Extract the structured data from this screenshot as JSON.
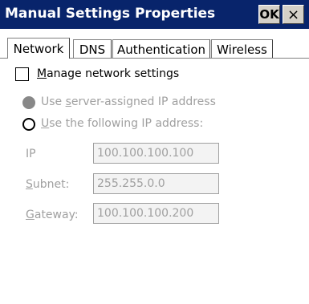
{
  "window": {
    "title": "Manual Settings Properties",
    "ok_label": "OK",
    "close_label": "×"
  },
  "tabs": [
    {
      "label": "Network",
      "active": true
    },
    {
      "label": "DNS",
      "active": false
    },
    {
      "label": "Authentication",
      "active": false
    },
    {
      "label": "Wireless",
      "active": false
    }
  ],
  "manage_network": {
    "label_prefix": "M",
    "label_rest": "anage network settings",
    "checked": false
  },
  "ip_mode": {
    "option_server_prefix": "Use ",
    "option_server_underlined": "s",
    "option_server_rest": "erver-assigned IP address",
    "option_manual_prefix": "",
    "option_manual_underlined": "U",
    "option_manual_rest": "se the following IP address:"
  },
  "fields": {
    "ip_label": "IP",
    "ip_value": "100.100.100.100",
    "subnet_label_underlined": "S",
    "subnet_label_rest": "ubnet:",
    "subnet_value": "255.255.0.0",
    "gateway_label_underlined": "G",
    "gateway_label_rest": "ateway:",
    "gateway_value": "100.100.100.200"
  },
  "colors": {
    "titlebar": "#08246b",
    "disabled_text": "#a0a0a0"
  }
}
